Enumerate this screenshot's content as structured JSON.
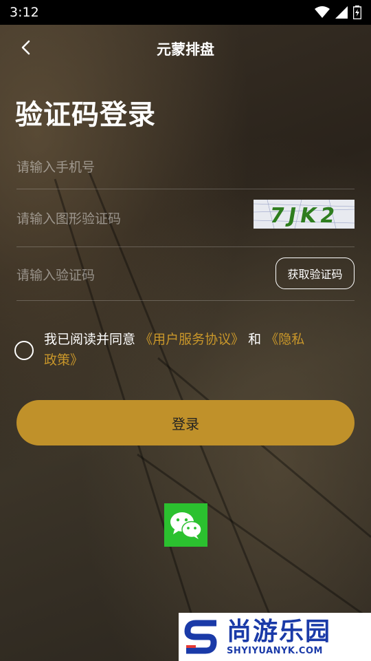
{
  "status_bar": {
    "time": "3:12"
  },
  "nav": {
    "title": "元蒙排盘"
  },
  "page": {
    "title": "验证码登录"
  },
  "form": {
    "phone_placeholder": "请输入手机号",
    "captcha_placeholder": "请输入图形验证码",
    "captcha_image_text": "7JK2",
    "code_placeholder": "请输入验证码",
    "get_code_label": "获取验证码"
  },
  "agreement": {
    "prefix": "我已阅读并同意",
    "user_agreement": "《用户服务协议》",
    "conjunction": "和",
    "privacy_policy": "《隐私政策》",
    "checked": false
  },
  "login_button": {
    "label": "登录"
  },
  "third_party": {
    "icon": "wechat-icon"
  },
  "watermark": {
    "logo_letter": "S",
    "cn": "尚游乐园",
    "en": "SHYIYUANYK.COM"
  },
  "colors": {
    "accent": "#c0912a",
    "link": "#c9972a",
    "wechat": "#2bc12f"
  }
}
